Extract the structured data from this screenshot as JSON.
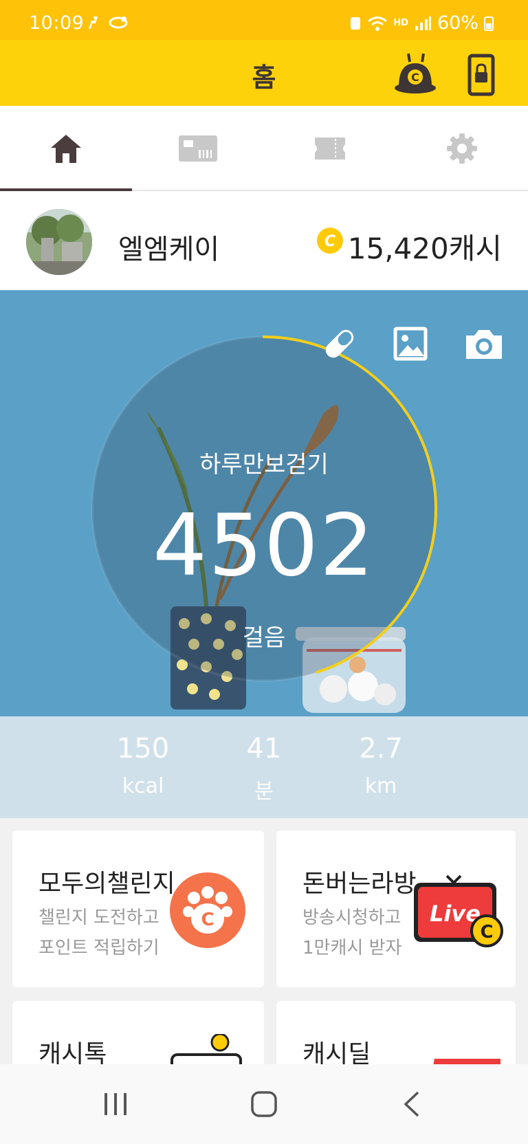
{
  "status_bar": {
    "time": "10:09",
    "battery": "60%",
    "hd_label": "HD"
  },
  "app_bar": {
    "title": "홈"
  },
  "tabs": [
    {
      "name": "home",
      "active": true
    },
    {
      "name": "gift",
      "active": false
    },
    {
      "name": "ticket",
      "active": false
    },
    {
      "name": "settings",
      "active": false
    }
  ],
  "profile": {
    "name": "엘엠케이",
    "cash": "15,420캐시",
    "coin_letter": "C"
  },
  "hero": {
    "label_top": "하루만보걷기",
    "steps": "4502",
    "label_bottom": "걸음",
    "progress": 0.45,
    "stats": [
      {
        "value": "150",
        "unit": "kcal"
      },
      {
        "value": "41",
        "unit": "분"
      },
      {
        "value": "2.7",
        "unit": "km"
      }
    ]
  },
  "cards": [
    {
      "title": "모두의챌린지",
      "line1": "챌린지 도전하고",
      "line2": "포인트 적립하기"
    },
    {
      "title": "돈버는라방",
      "line1": "방송시청하고",
      "line2": "1만캐시 받자",
      "badge": "Live"
    },
    {
      "title": "캐시톡"
    },
    {
      "title": "캐시딜"
    }
  ],
  "colors": {
    "accent": "#fed20a",
    "status_bar": "#fec309",
    "text_dark": "#3e3535",
    "progress_arc": "#f3cf1a"
  }
}
